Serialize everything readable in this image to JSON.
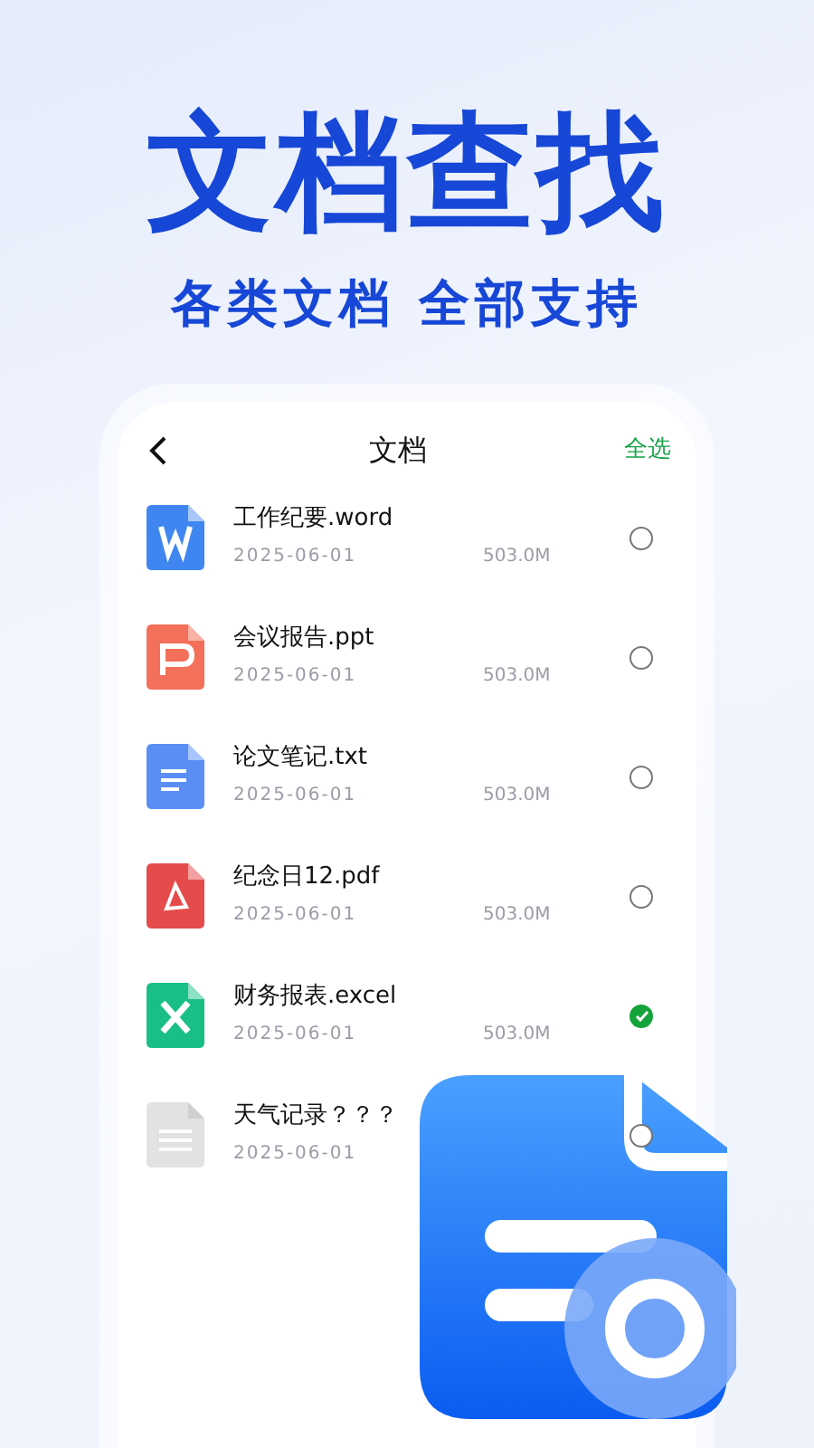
{
  "headline": "文档查找",
  "subtitle": "各类文档 全部支持",
  "screen": {
    "title": "文档",
    "action": "全选",
    "files": [
      {
        "kind": "word",
        "name": "工作纪要.word",
        "date": "2025-06-01",
        "size": "503.0M",
        "selected": false
      },
      {
        "kind": "ppt",
        "name": "会议报告.ppt",
        "date": "2025-06-01",
        "size": "503.0M",
        "selected": false
      },
      {
        "kind": "txt",
        "name": "论文笔记.txt",
        "date": "2025-06-01",
        "size": "503.0M",
        "selected": false
      },
      {
        "kind": "pdf",
        "name": "纪念日12.pdf",
        "date": "2025-06-01",
        "size": "503.0M",
        "selected": false
      },
      {
        "kind": "excel",
        "name": "财务报表.excel",
        "date": "2025-06-01",
        "size": "503.0M",
        "selected": true
      },
      {
        "kind": "other",
        "name": "天气记录？？？",
        "date": "2025-06-01",
        "selected": false
      }
    ]
  }
}
